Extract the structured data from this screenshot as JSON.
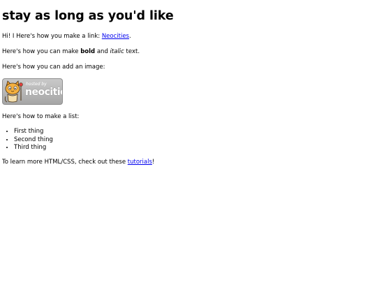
{
  "heading": "stay as long as you'd like",
  "intro": {
    "prefix": "Hi! I Here's how you make a link: ",
    "link_text": "Neocities",
    "suffix": "."
  },
  "formatting": {
    "prefix": "Here's how you can make ",
    "bold_text": "bold",
    "middle": " and ",
    "italic_text": "italic",
    "suffix": " text."
  },
  "image_intro": "Here's how you can add an image:",
  "badge": {
    "small_text": "hosted by",
    "brand_text": "neocities"
  },
  "list_intro": "Here's how to make a list:",
  "list_items": [
    "First thing",
    "Second thing",
    "Third thing"
  ],
  "outro": {
    "prefix": "To learn more HTML/CSS, check out these ",
    "link_text": "tutorials",
    "suffix": "!"
  }
}
